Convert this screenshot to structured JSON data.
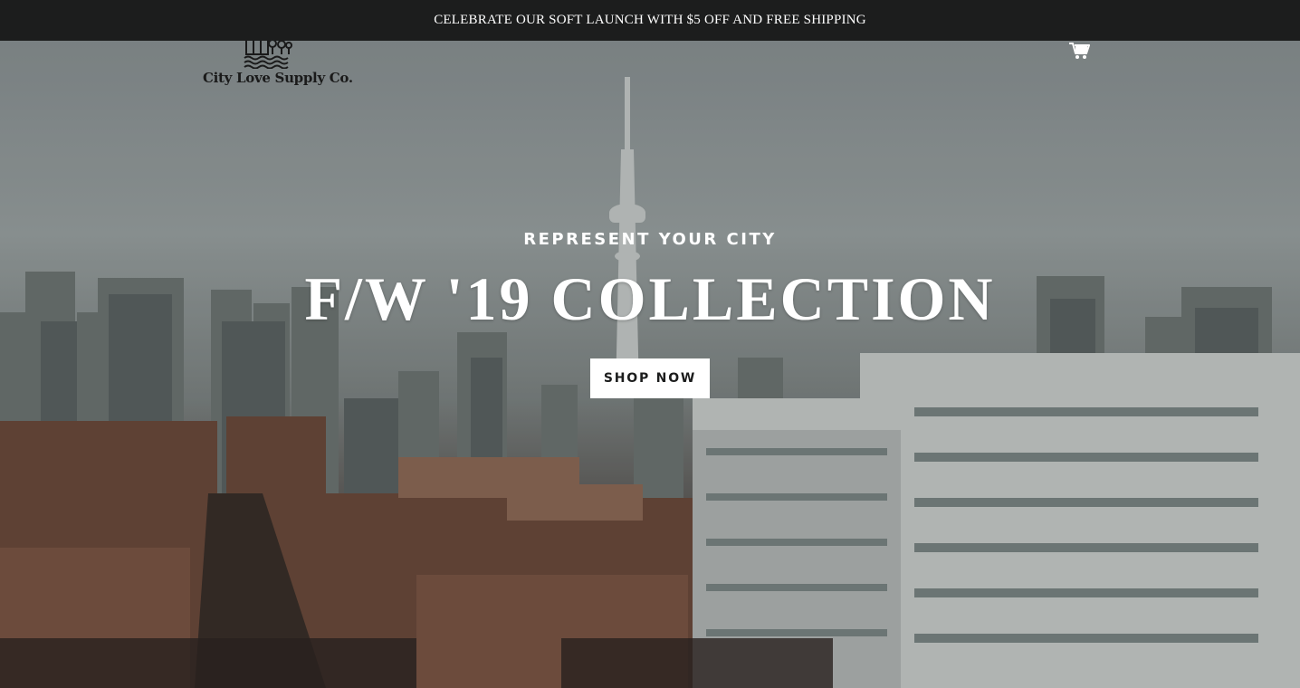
{
  "announcement": {
    "text": "CELEBRATE OUR SOFT LAUNCH WITH $5 OFF AND FREE SHIPPING"
  },
  "header": {
    "logo_text": "City Love Supply Co.",
    "logo_icon": "city-skyline-logo-icon",
    "cart_icon": "cart-icon"
  },
  "hero": {
    "subheading": "REPRESENT YOUR CITY",
    "heading": "F/W '19 COLLECTION",
    "button_label": "SHOP NOW",
    "image_description_icon": "toronto-skyline-image"
  },
  "colors": {
    "announcement_bg": "#1c1d1d",
    "text_light": "#ffffff",
    "button_bg": "#ffffff",
    "button_text": "#1c1d1d"
  }
}
